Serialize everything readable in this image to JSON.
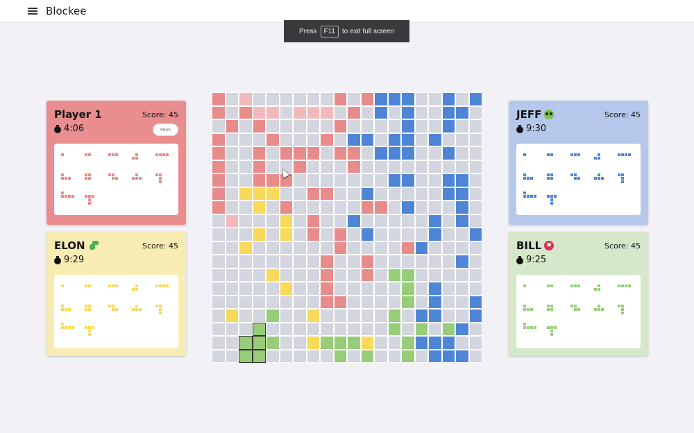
{
  "app": {
    "title": "Blockee"
  },
  "fullscreen_toast": {
    "pre": "Press",
    "key": "F11",
    "post": "to exit full screen"
  },
  "colors": {
    "red": "#e88b8b",
    "light_red": "#f2b9bd",
    "yellow": "#f8d95a",
    "green": "#97cc79",
    "blue": "#4f85d6",
    "empty": "#d3d6df"
  },
  "players": [
    {
      "id": "player1",
      "name": "Player 1",
      "emoji": "",
      "score": "Score: 45",
      "time": "4:06",
      "pass_label": "PASS",
      "color": "red",
      "panel_bg": "#e98d8e",
      "tray_rows": [
        5,
        5,
        2
      ]
    },
    {
      "id": "jeff",
      "name": "JEFF",
      "emoji": "alien-icon",
      "score": "Score: 45",
      "time": "9:30",
      "color": "blue",
      "panel_bg": "#b5c8ec",
      "tray_rows": [
        5,
        5,
        2
      ]
    },
    {
      "id": "elon",
      "name": "ELON",
      "emoji": "dinosaur-icon",
      "score": "Score: 45",
      "time": "9:29",
      "color": "yellow",
      "panel_bg": "#f8ecb2",
      "tray_rows": [
        5,
        5,
        2
      ]
    },
    {
      "id": "bill",
      "name": "BILL",
      "emoji": "monster-icon",
      "score": "Score: 45",
      "time": "9:25",
      "color": "green",
      "panel_bg": "#d5e8c9",
      "tray_rows": [
        5,
        5,
        2
      ]
    }
  ],
  "board": {
    "size": 20,
    "legend": {
      ".": "empty",
      "R": "red",
      "r": "light_red",
      "Y": "yellow",
      "G": "green",
      "B": "blue",
      "H": "green_selected"
    },
    "rows": [
      "R.r......R.RBBB..B.B",
      "R.Rrr.rrr.R.B.B..BB.",
      ".R.R.....R....B..B..",
      "R...R...R.BB.BB.B...",
      "R..R.RRR.RR.BBB..B..",
      "R..R..R...R.........",
      "R..RRR.......BB..BB.",
      "R.YYY..RR..B.....BB.",
      "R..Y.R.....RR.B...B.",
      ".r...Y.R..B.....B.B.",
      "...Y.Y.R.R.B....B..B",
      "..Y......R....RB....",
      "........R..R......B.",
      "....Y...R..R.GG.....",
      ".....Y..R.....G.B...",
      "........RR....G.B..B",
      ".Y..G..Y.....G.BB..B",
      "...Y.........G.G.GB.",
      "....G..YGGGY..GBBB..",
      ".........G.G..G.BBB."
    ]
  }
}
